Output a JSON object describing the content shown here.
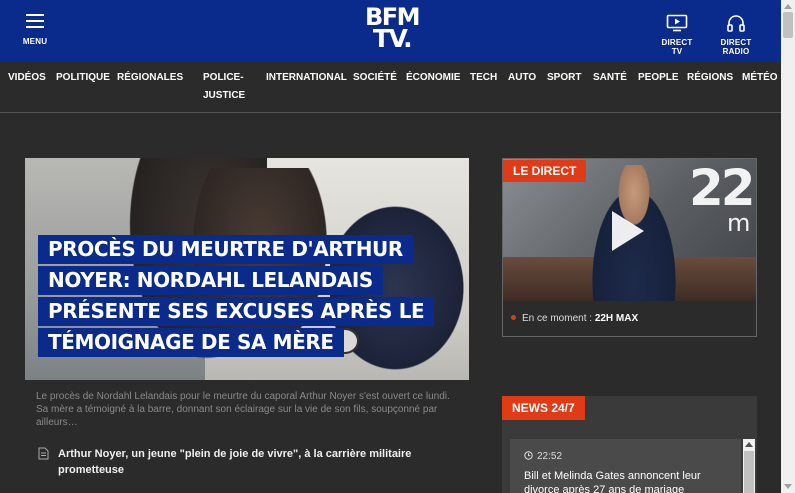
{
  "header": {
    "menu_label": "MENU",
    "logo_line1": "BFM",
    "logo_line2": "TV.",
    "direct_tv_label": "DIRECT TV",
    "direct_radio_label": "DIRECT RADIO",
    "brand_color": "#0a2b8c"
  },
  "nav": {
    "items": [
      "VIDÉOS",
      "POLITIQUE",
      "RÉGIONALES",
      "POLICE-",
      "JUSTICE",
      "INTERNATIONAL",
      "SOCIÉTÉ",
      "ÉCONOMIE",
      "TECH",
      "AUTO",
      "SPORT",
      "SANTÉ",
      "PEOPLE",
      "RÉGIONS",
      "MÉTÉO"
    ]
  },
  "hero": {
    "title": "PROCÈS DU MEURTRE D'ARTHUR NOYER: NORDAHL LELANDAIS PRÉSENTE SES EXCUSES APRÈS LE TÉMOIGNAGE DE SA MÈRE",
    "description": "Le procès de Nordahl Lelandais pour le meurtre du caporal Arthur Noyer s'est ouvert ce lundi. Sa mère a témoigné à la barre, donnant son éclairage sur la vie de son fils, soupçonné par ailleurs…",
    "related": "Arthur Noyer, un jeune \"plein de joie de vivre\", à la carrière militaire prometteuse"
  },
  "live": {
    "tag": "LE DIRECT",
    "channel_graphic": "22",
    "channel_graphic_suffix": "m",
    "now_label": "En ce moment :",
    "now_program": "22H MAX",
    "accent_color": "#e13a17"
  },
  "news": {
    "tag": "NEWS 24/7",
    "time": "22:52",
    "headline": "Bill et Melinda Gates annoncent leur divorce après 27 ans de mariage"
  }
}
